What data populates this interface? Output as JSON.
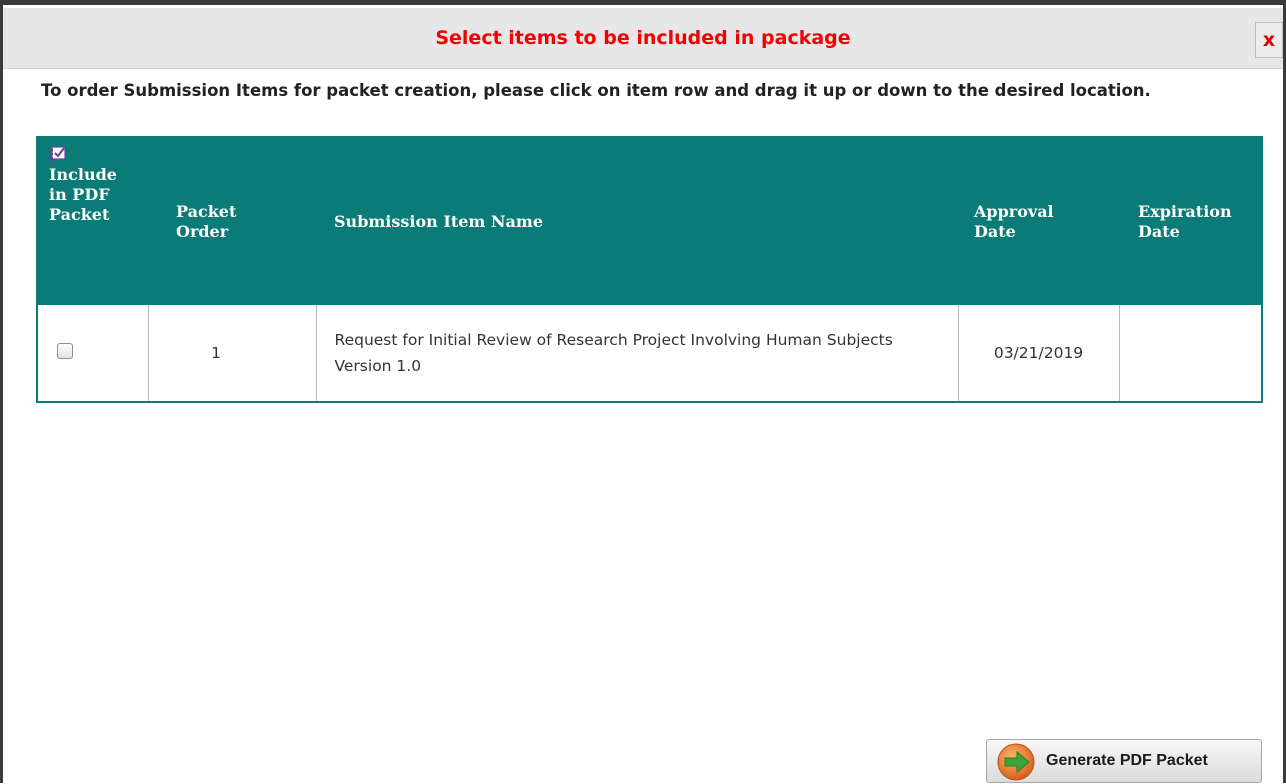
{
  "dialog": {
    "title": "Select items to be included in package",
    "close_label": "x",
    "instructions": "To order Submission Items for packet creation, please click on item row and drag it up or down to the desired location."
  },
  "table": {
    "headers": {
      "include": "Include in PDF Packet",
      "order": "Packet Order",
      "name": "Submission Item Name",
      "approval": "Approval Date",
      "expiration": "Expiration Date"
    },
    "rows": [
      {
        "checked": false,
        "order": "1",
        "name": "Request for Initial Review of Research Project Involving Human Subjects Version 1.0",
        "approval_date": "03/21/2019",
        "expiration_date": ""
      }
    ]
  },
  "footer": {
    "generate_label": "Generate PDF Packet",
    "generate_icon": "arrow-right-circle-icon"
  },
  "colors": {
    "title_red": "#f50000",
    "header_teal": "#0b7b78",
    "icon_orange": "#e8742a",
    "icon_green": "#3aa63a"
  }
}
